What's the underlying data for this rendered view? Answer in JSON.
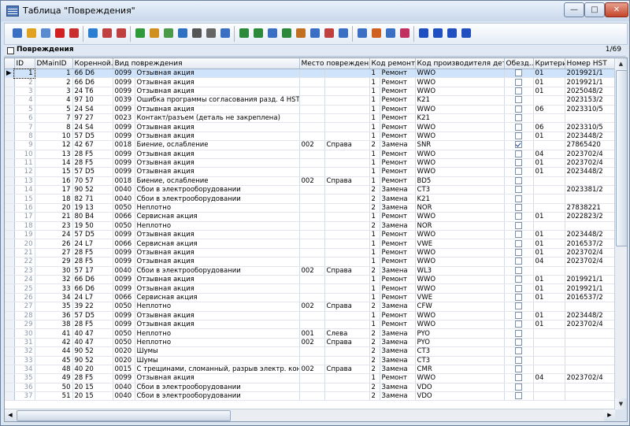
{
  "window": {
    "title": "Таблица \"Повреждения\"",
    "min": "—",
    "max": "□",
    "close": "✕"
  },
  "toolbar": {
    "icons": [
      "save-icon",
      "edit-icon",
      "copy-icon",
      "delete-icon",
      "cancel-icon",
      "filter-icon",
      "filter-add-icon",
      "filter-remove-icon",
      "refresh-icon",
      "sort-icon",
      "sort-filter-icon",
      "sql-icon",
      "binoculars-icon",
      "print-icon",
      "preview-icon",
      "export-icon",
      "export-excel-icon",
      "export-word-icon",
      "export-csv-icon",
      "import-icon",
      "report-icon",
      "chart-icon",
      "chart-bar-icon",
      "music-icon",
      "columns-icon",
      "table-icon",
      "layout-icon",
      "first-icon",
      "prev-icon",
      "next-icon",
      "last-icon"
    ]
  },
  "panel": {
    "label": "Повреждения",
    "record_count": "1/69"
  },
  "grid": {
    "columns": [
      "ID",
      "DMainID",
      "Коренной...",
      "Вид повреждения",
      "Место повреждения",
      "Код ремонта",
      "Код производителя дета...",
      "Обезд...",
      "Критерии",
      "Номер HST"
    ],
    "rows": [
      [
        "1",
        "1",
        "66 D6",
        "0099",
        "Отзывная акция",
        "",
        "",
        "1",
        "Ремонт",
        "WWO",
        false,
        "01",
        "2019921/1"
      ],
      [
        "2",
        "2",
        "66 D6",
        "0099",
        "Отзывная акция",
        "",
        "",
        "1",
        "Ремонт",
        "WWO",
        false,
        "01",
        "2019921/1"
      ],
      [
        "3",
        "3",
        "24 T6",
        "0099",
        "Отзывная акция",
        "",
        "",
        "1",
        "Ремонт",
        "WWO",
        false,
        "01",
        "2025048/2"
      ],
      [
        "4",
        "4",
        "97 10",
        "0039",
        "Ошибка программы согласования разд. 4 HST",
        "",
        "",
        "1",
        "Ремонт",
        "K21",
        false,
        "",
        "2023153/2"
      ],
      [
        "5",
        "5",
        "24 S4",
        "0099",
        "Отзывная акция",
        "",
        "",
        "1",
        "Ремонт",
        "WWO",
        false,
        "06",
        "2023310/5"
      ],
      [
        "6",
        "7",
        "97 27",
        "0023",
        "Контакт/разъем (деталь не закреплена)",
        "",
        "",
        "1",
        "Ремонт",
        "K21",
        false,
        "",
        ""
      ],
      [
        "7",
        "8",
        "24 S4",
        "0099",
        "Отзывная акция",
        "",
        "",
        "1",
        "Ремонт",
        "WWO",
        false,
        "06",
        "2023310/5"
      ],
      [
        "8",
        "10",
        "57 D5",
        "0099",
        "Отзывная акция",
        "",
        "",
        "1",
        "Ремонт",
        "WWO",
        false,
        "01",
        "2023448/2"
      ],
      [
        "9",
        "12",
        "42 67",
        "0018",
        "Биение, ослабление",
        "002",
        "Справа",
        "2",
        "Замена",
        "SNR",
        true,
        "",
        "27865420"
      ],
      [
        "10",
        "13",
        "28 F5",
        "0099",
        "Отзывная акция",
        "",
        "",
        "1",
        "Ремонт",
        "WWO",
        false,
        "04",
        "2023702/4"
      ],
      [
        "11",
        "14",
        "28 F5",
        "0099",
        "Отзывная акция",
        "",
        "",
        "1",
        "Ремонт",
        "WWO",
        false,
        "01",
        "2023702/4"
      ],
      [
        "12",
        "15",
        "57 D5",
        "0099",
        "Отзывная акция",
        "",
        "",
        "1",
        "Ремонт",
        "WWO",
        false,
        "01",
        "2023448/2"
      ],
      [
        "13",
        "16",
        "70 57",
        "0018",
        "Биение, ослабление",
        "002",
        "Справа",
        "1",
        "Ремонт",
        "BD5",
        false,
        "",
        ""
      ],
      [
        "14",
        "17",
        "90 52",
        "0040",
        "Сбои в электрооборудовании",
        "",
        "",
        "2",
        "Замена",
        "CT3",
        false,
        "",
        "2023381/2"
      ],
      [
        "15",
        "18",
        "82 71",
        "0040",
        "Сбои в электрооборудовании",
        "",
        "",
        "2",
        "Замена",
        "K21",
        false,
        "",
        ""
      ],
      [
        "16",
        "20",
        "19 13",
        "0050",
        "Неплотно",
        "",
        "",
        "2",
        "Замена",
        "NOR",
        false,
        "",
        "27838221"
      ],
      [
        "17",
        "21",
        "80 B4",
        "0066",
        "Сервисная акция",
        "",
        "",
        "1",
        "Ремонт",
        "WWO",
        false,
        "01",
        "2022823/2"
      ],
      [
        "18",
        "23",
        "19 50",
        "0050",
        "Неплотно",
        "",
        "",
        "2",
        "Замена",
        "NOR",
        false,
        "",
        ""
      ],
      [
        "19",
        "24",
        "57 D5",
        "0099",
        "Отзывная акция",
        "",
        "",
        "1",
        "Ремонт",
        "WWO",
        false,
        "01",
        "2023448/2"
      ],
      [
        "20",
        "26",
        "24 L7",
        "0066",
        "Сервисная акция",
        "",
        "",
        "1",
        "Ремонт",
        "VWE",
        false,
        "01",
        "2016537/2"
      ],
      [
        "21",
        "27",
        "28 F5",
        "0099",
        "Отзывная акция",
        "",
        "",
        "1",
        "Ремонт",
        "WWO",
        false,
        "01",
        "2023702/4"
      ],
      [
        "22",
        "29",
        "28 F5",
        "0099",
        "Отзывная акция",
        "",
        "",
        "1",
        "Ремонт",
        "WWO",
        false,
        "04",
        "2023702/4"
      ],
      [
        "23",
        "30",
        "57 17",
        "0040",
        "Сбои в электрооборудовании",
        "002",
        "Справа",
        "2",
        "Замена",
        "WL3",
        false,
        "",
        ""
      ],
      [
        "24",
        "32",
        "66 D6",
        "0099",
        "Отзывная акция",
        "",
        "",
        "1",
        "Ремонт",
        "WWO",
        false,
        "01",
        "2019921/1"
      ],
      [
        "25",
        "33",
        "66 D6",
        "0099",
        "Отзывная акция",
        "",
        "",
        "1",
        "Ремонт",
        "WWO",
        false,
        "01",
        "2019921/1"
      ],
      [
        "26",
        "34",
        "24 L7",
        "0066",
        "Сервисная акция",
        "",
        "",
        "1",
        "Ремонт",
        "VWE",
        false,
        "01",
        "2016537/2"
      ],
      [
        "27",
        "35",
        "39 22",
        "0050",
        "Неплотно",
        "002",
        "Справа",
        "2",
        "Замена",
        "CFW",
        false,
        "",
        ""
      ],
      [
        "28",
        "36",
        "57 D5",
        "0099",
        "Отзывная акция",
        "",
        "",
        "1",
        "Ремонт",
        "WWO",
        false,
        "01",
        "2023448/2"
      ],
      [
        "29",
        "38",
        "28 F5",
        "0099",
        "Отзывная акция",
        "",
        "",
        "1",
        "Ремонт",
        "WWO",
        false,
        "01",
        "2023702/4"
      ],
      [
        "30",
        "41",
        "40 47",
        "0050",
        "Неплотно",
        "001",
        "Слева",
        "2",
        "Замена",
        "PYO",
        false,
        "",
        ""
      ],
      [
        "31",
        "42",
        "40 47",
        "0050",
        "Неплотно",
        "002",
        "Справа",
        "2",
        "Замена",
        "PYO",
        false,
        "",
        ""
      ],
      [
        "32",
        "44",
        "90 52",
        "0020",
        "Шумы",
        "",
        "",
        "2",
        "Замена",
        "CT3",
        false,
        "",
        ""
      ],
      [
        "33",
        "45",
        "90 52",
        "0020",
        "Шумы",
        "",
        "",
        "2",
        "Замена",
        "CT3",
        false,
        "",
        ""
      ],
      [
        "34",
        "48",
        "40 20",
        "0015",
        "С трещинами, сломанный, разрыв электр. контакта",
        "002",
        "Справа",
        "2",
        "Замена",
        "CMR",
        false,
        "",
        ""
      ],
      [
        "35",
        "49",
        "28 F5",
        "0099",
        "Отзывная акция",
        "",
        "",
        "1",
        "Ремонт",
        "WWO",
        false,
        "04",
        "2023702/4"
      ],
      [
        "36",
        "50",
        "20 15",
        "0040",
        "Сбои в электрооборудовании",
        "",
        "",
        "2",
        "Замена",
        "VDO",
        false,
        "",
        ""
      ],
      [
        "37",
        "51",
        "20 15",
        "0040",
        "Сбои в электрооборудовании",
        "",
        "",
        "2",
        "Замена",
        "VDO",
        false,
        "",
        ""
      ]
    ]
  }
}
